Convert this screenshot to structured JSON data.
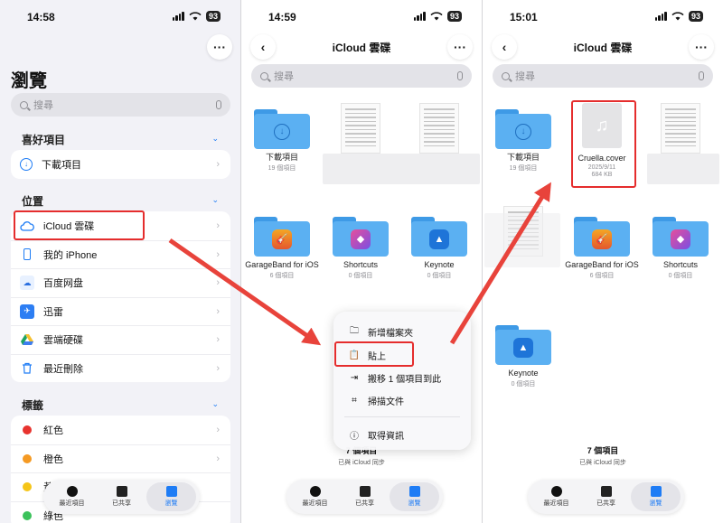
{
  "status_bar": [
    {
      "time": "14:58",
      "battery": "93"
    },
    {
      "time": "14:59",
      "battery": "93"
    },
    {
      "time": "15:01",
      "battery": "93"
    }
  ],
  "browse": {
    "title": "瀏覽",
    "search_placeholder": "搜尋",
    "favorites_header": "喜好項目",
    "favorites": [
      {
        "label": "下載項目",
        "icon": "download-icon"
      }
    ],
    "locations_header": "位置",
    "locations": [
      {
        "label": "iCloud 雲碟",
        "icon": "icloud-icon"
      },
      {
        "label": "我的 iPhone",
        "icon": "iphone-icon"
      },
      {
        "label": "百度网盘",
        "icon": "baidu-pan-icon"
      },
      {
        "label": "迅雷",
        "icon": "xunlei-icon"
      },
      {
        "label": "雲端硬碟",
        "icon": "google-drive-icon"
      },
      {
        "label": "最近刪除",
        "icon": "trash-icon"
      }
    ],
    "tags_header": "標籤",
    "tags": [
      {
        "label": "紅色",
        "color": "#e8332e"
      },
      {
        "label": "橙色",
        "color": "#f59a23"
      },
      {
        "label": "黃色",
        "color": "#f5c518"
      },
      {
        "label": "綠色",
        "color": "#3cc25b"
      }
    ]
  },
  "icloud_view": {
    "title": "iCloud 雲碟",
    "search_placeholder": "搜尋",
    "items": [
      {
        "name": "下載項目",
        "sub": "19 個項目"
      },
      {
        "name": "GarageBand for iOS",
        "sub": "6 個項目"
      },
      {
        "name": "Shortcuts",
        "sub": "0 個項目"
      },
      {
        "name": "Keynote",
        "sub": "0 個項目"
      }
    ],
    "footer_count": "7 個項目",
    "footer_sync": "已與 iCloud 同步"
  },
  "context_menu": {
    "items": [
      {
        "label": "新增檔案夾",
        "icon": "new-folder-icon"
      },
      {
        "label": "貼上",
        "icon": "paste-icon"
      },
      {
        "label": "搬移 1 個項目到此",
        "icon": "move-icon"
      },
      {
        "label": "掃描文件",
        "icon": "scan-icon"
      },
      {
        "label": "取得資訊",
        "icon": "info-icon"
      }
    ]
  },
  "icloud_after": {
    "title": "iCloud 雲碟",
    "search_placeholder": "搜尋",
    "items": [
      {
        "name": "下載項目",
        "sub": "19 個項目"
      },
      {
        "name": "Cruella.cover",
        "sub": "2025/9/11",
        "size": "684 KB"
      },
      {
        "name": "GarageBand for iOS",
        "sub": "6 個項目"
      },
      {
        "name": "Shortcuts",
        "sub": "0 個項目"
      },
      {
        "name": "Keynote",
        "sub": "0 個項目"
      }
    ],
    "footer_count": "7 個項目",
    "footer_sync": "已與 iCloud 同步"
  },
  "tab_bar": {
    "items": [
      {
        "label": "最近項目",
        "icon": "clock-icon"
      },
      {
        "label": "已共享",
        "icon": "shared-folder-icon"
      },
      {
        "label": "瀏覽",
        "icon": "folder-icon",
        "selected": true
      }
    ]
  },
  "colors": {
    "accent": "#1e7cf5",
    "highlight": "#e52d2d",
    "arrow": "#e8433b"
  }
}
